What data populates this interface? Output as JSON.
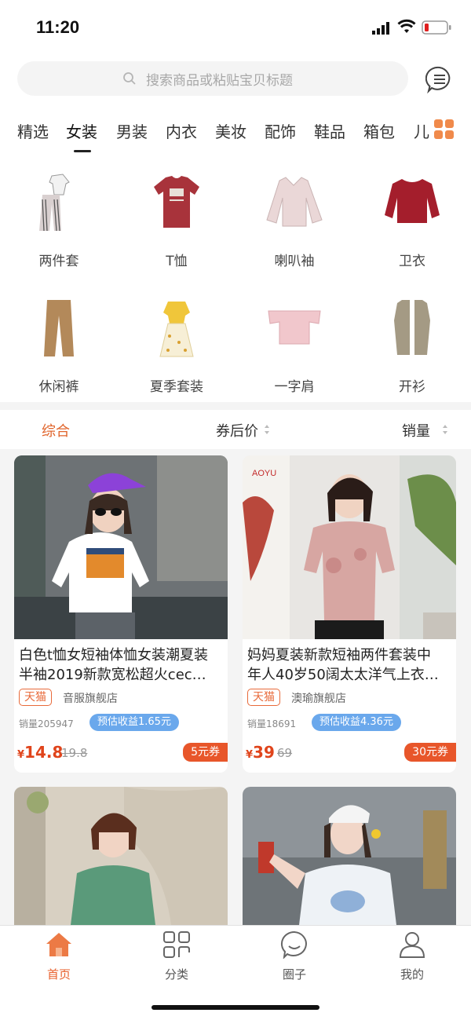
{
  "status": {
    "time": "11:20"
  },
  "search": {
    "placeholder": "搜索商品或粘贴宝贝标题"
  },
  "tabs": [
    "精选",
    "女装",
    "男装",
    "内衣",
    "美妆",
    "配饰",
    "鞋品",
    "箱包",
    "儿"
  ],
  "categories": [
    {
      "label": "两件套",
      "icon": "two-piece-set-image"
    },
    {
      "label": "T恤",
      "icon": "tshirt-image"
    },
    {
      "label": "喇叭袖",
      "icon": "flare-sleeve-image"
    },
    {
      "label": "卫衣",
      "icon": "sweatshirt-image"
    },
    {
      "label": "休闲裤",
      "icon": "casual-pants-image"
    },
    {
      "label": "夏季套装",
      "icon": "summer-set-image"
    },
    {
      "label": "一字肩",
      "icon": "off-shoulder-image"
    },
    {
      "label": "开衫",
      "icon": "cardigan-image"
    }
  ],
  "sort": {
    "comprehensive": "综合",
    "after_coupon_price": "券后价",
    "sales": "销量"
  },
  "products": [
    {
      "title_line1": "白色t恤女短袖体恤女装潮夏装",
      "title_line2": "半袖2019新款宽松超火cec…",
      "platform": "天猫",
      "shop": "音服旗舰店",
      "sales": "销量205947",
      "earn": "预估收益1.65元",
      "price_symbol": "¥",
      "price": "14.8",
      "old_price": "19.8",
      "coupon": "5元券"
    },
    {
      "title_line1": "妈妈夏装新款短袖两件套装中",
      "title_line2": "年人40岁50阔太太洋气上衣…",
      "platform": "天猫",
      "shop": "澳瑜旗舰店",
      "sales": "销量18691",
      "earn": "预估收益4.36元",
      "price_symbol": "¥",
      "price": "39",
      "old_price": "69",
      "coupon": "30元券",
      "brand_logo": "AOYU"
    }
  ],
  "tabbar": [
    {
      "label": "首页",
      "icon": "home-icon"
    },
    {
      "label": "分类",
      "icon": "category-icon"
    },
    {
      "label": "圈子",
      "icon": "circle-icon"
    },
    {
      "label": "我的",
      "icon": "profile-icon"
    }
  ],
  "colors": {
    "accent": "#e8602c",
    "price": "#e0441b",
    "earn_badge": "#6aa8ec"
  }
}
